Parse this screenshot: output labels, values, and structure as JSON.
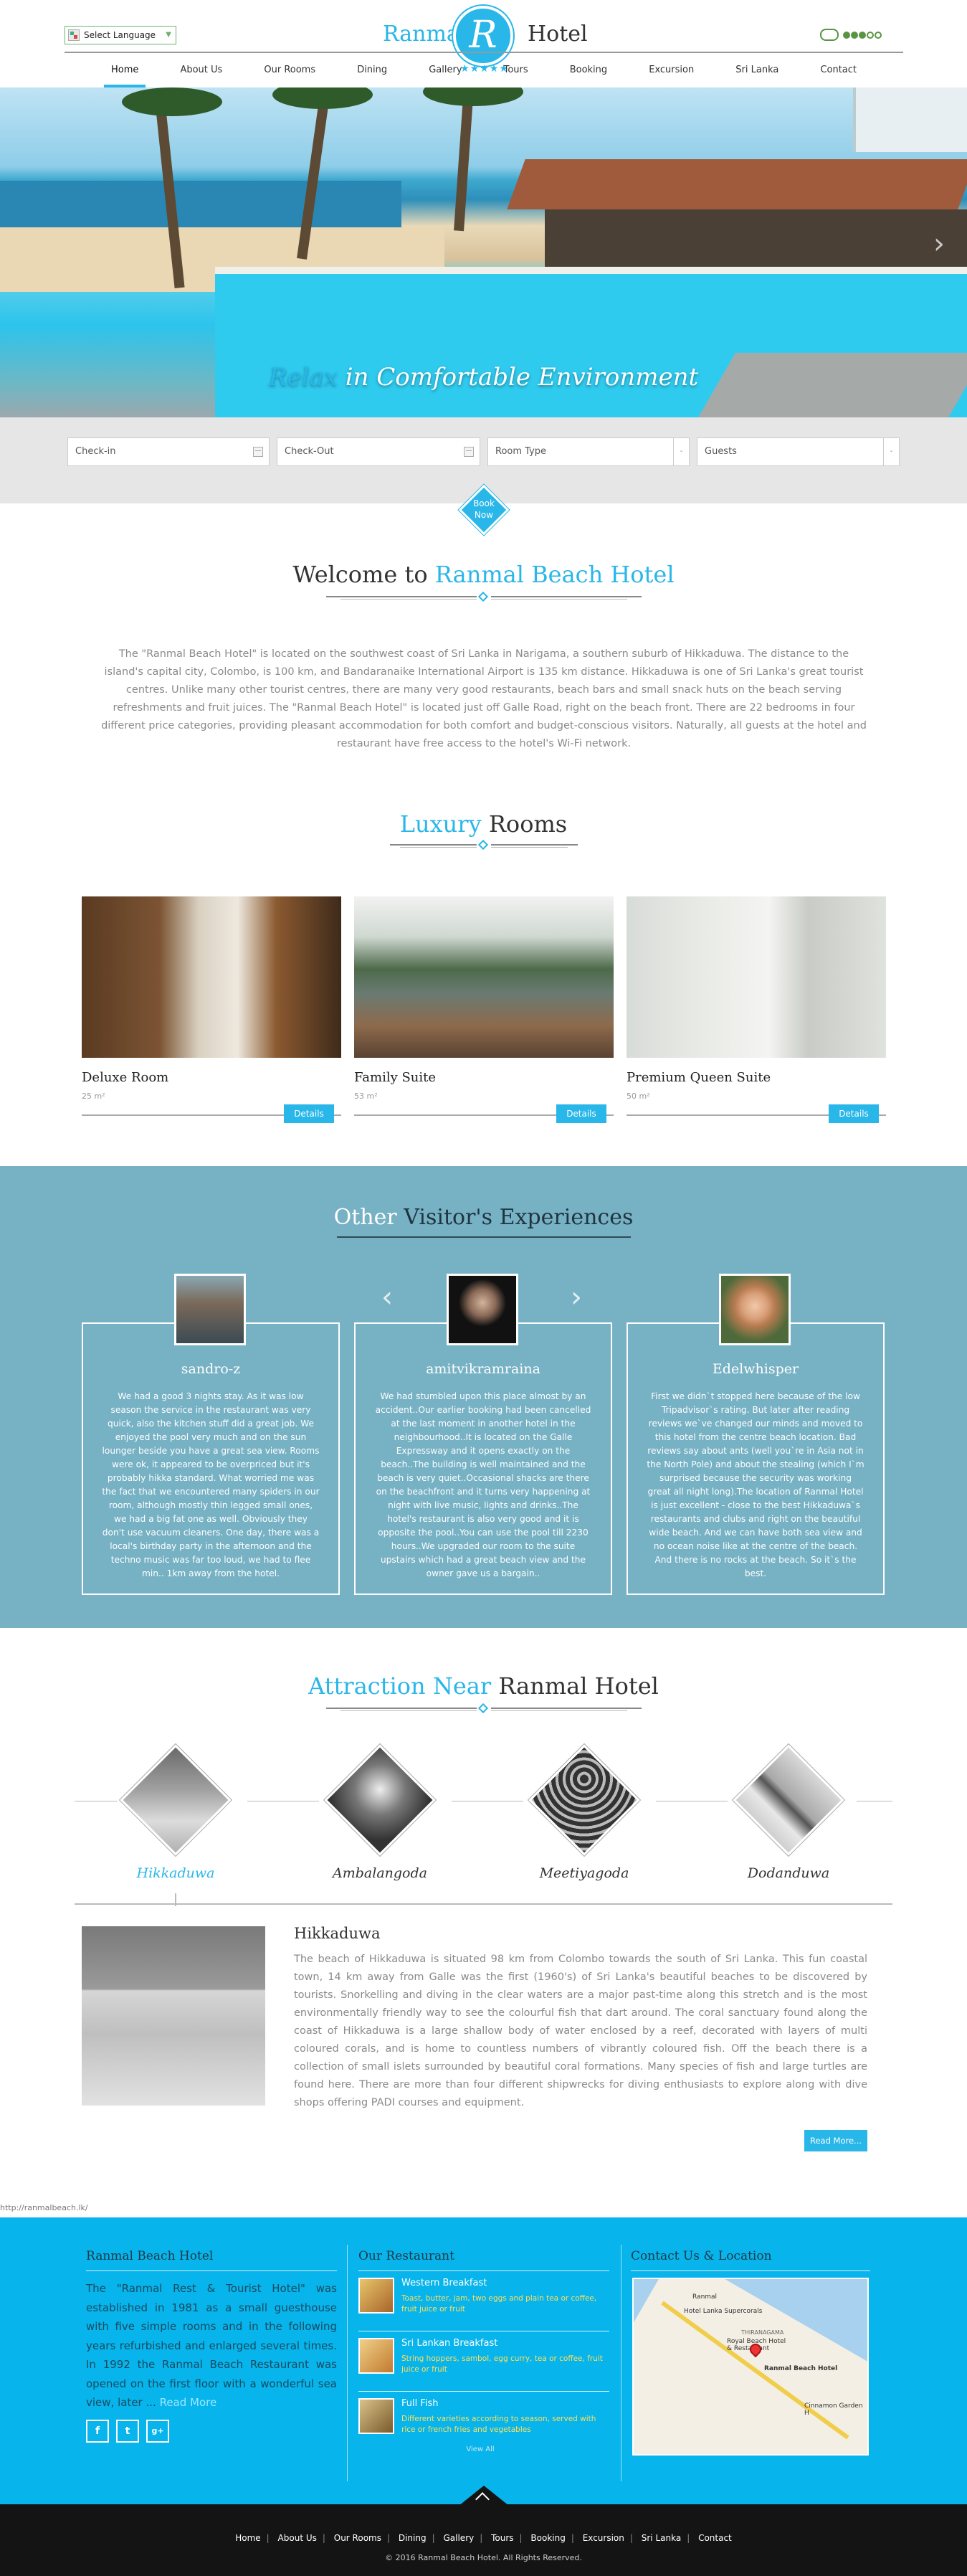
{
  "header": {
    "language_select": "Select Language",
    "logo_left": "Ranmal",
    "logo_letter": "R",
    "logo_right": "Hotel",
    "logo_stars": "★★★★★",
    "nav": [
      "Home",
      "About Us",
      "Our Rooms",
      "Dining",
      "Gallery",
      "Tours",
      "Booking",
      "Excursion",
      "Sri Lanka",
      "Contact"
    ],
    "active_nav": "Home"
  },
  "hero": {
    "caption_highlight": "Relax",
    "caption_rest": " in Comfortable Environment",
    "next_arrow": "›"
  },
  "booking": {
    "checkin_placeholder": "Check-in",
    "checkout_placeholder": "Check-Out",
    "room_type": "Room Type",
    "guests": "Guests",
    "book_now_line1": "Book",
    "book_now_line2": "Now"
  },
  "welcome": {
    "title_plain": "Welcome to ",
    "title_highlight": "Ranmal Beach Hotel",
    "text": "The \"Ranmal Beach Hotel\" is located on the southwest coast of Sri Lanka in Narigama, a southern suburb of Hikkaduwa. The distance to the island's capital city, Colombo, is 100 km, and Bandaranaike International Airport is 135 km distance. Hikkaduwa is one of Sri Lanka's great tourist centres. Unlike many other tourist centres, there are many very good restaurants, beach bars and small snack huts on the beach serving refreshments and fruit juices. The \"Ranmal Beach Hotel\" is located just off Galle Road, right on the beach front. There are 22 bedrooms in four different price categories, providing pleasant accommodation for both comfort and budget-conscious visitors. Naturally, all guests at the hotel and restaurant have free access to the hotel's Wi-Fi network."
  },
  "rooms": {
    "title_highlight": "Luxury",
    "title_plain": " Rooms",
    "items": [
      {
        "name": "Deluxe Room",
        "size": "25 m²",
        "button": "Details"
      },
      {
        "name": "Family Suite",
        "size": "53 m²",
        "button": "Details"
      },
      {
        "name": "Premium Queen Suite",
        "size": "50 m²",
        "button": "Details"
      }
    ]
  },
  "experiences": {
    "title_highlight": "Other",
    "title_plain": " Visitor's Experiences",
    "prev_arrow": "‹",
    "next_arrow": "›",
    "reviews": [
      {
        "name": "sandro-z",
        "text": "We had a good 3 nights stay. As it was low season the service in the restaurant was very quick, also the kitchen stuff did a great job. We enjoyed the pool very much and on the sun lounger beside you have a great sea view. Rooms were ok, it appeared to be overpriced but it's probably hikka standard. What worried me was the fact that we encountered many spiders in our room, although mostly thin legged small ones, we had a big fat one as well. Obviously they don't use vacuum cleaners. One day, there was a local's birthday party in the afternoon and the techno music was far too loud, we had to flee min.. 1km away from the hotel."
      },
      {
        "name": "amitvikramraina",
        "text": "We had stumbled upon this place almost by an accident..Our earlier booking had been cancelled at the last moment in another hotel in the neighbourhood..It is located on the Galle Expressway and it opens exactly on the beach..The building is well maintained and the beach is very quiet..Occasional shacks are there on the beachfront and it turns very happening at night with live music, lights and drinks..The hotel's restaurant is also very good and it is opposite the pool..You can use the pool till 2230 hours..We upgraded our room to the suite upstairs which had a great beach view and the owner gave us a bargain.."
      },
      {
        "name": "Edelwhisper",
        "text": "First we didn`t stopped here because of the low Tripadvisor`s rating. But later after reading reviews we`ve changed our minds and moved to this hotel from the centre beach location. Bad reviews say about ants (well you`re in Asia not in the North Pole) and about the stealing (which I`m surprised because the security was working great all night long).The location of Ranmal Hotel is just excellent - close to the best Hikkaduwa`s restaurants and clubs and right on the beautiful wide beach. And we can have both sea view and no ocean noise like at the centre of the beach. And there is no rocks at the beach. So it`s the best."
      }
    ]
  },
  "attractions": {
    "title_highlight": "Attraction Near",
    "title_plain": " Ranmal Hotel",
    "items": [
      "Hikkaduwa",
      "Ambalangoda",
      "Meetiyagoda",
      "Dodanduwa"
    ],
    "active": "Hikkaduwa",
    "detail_name": "Hikkaduwa",
    "detail_text": "The beach of Hikkaduwa is situated 98 km from Colombo towards the south of Sri Lanka. This fun coastal town, 14 km away from Galle was the first (1960's) of Sri Lanka's beautiful beaches to be discovered by tourists. Snorkelling and diving in the clear waters are a major past-time along this stretch and is the most environmentally friendly way to see the colourful fish that dart around. The coral sanctuary found along the coast of Hikkaduwa is a large shallow body of water enclosed by a reef, decorated with layers of multi coloured corals, and is home to countless numbers of vibrantly coloured fish. Off the beach there is a collection of small islets surrounded by beautiful coral formations. Many species of fish and large turtles are found here. There are more than four different shipwrecks for diving enthusiasts to explore along with dive shops offering PADI courses and equipment.",
    "read_more": "Read More..."
  },
  "status_url": "http://ranmalbeach.lk/",
  "footer": {
    "about_title": "Ranmal Beach Hotel",
    "about_text": "The \"Ranmal Rest & Tourist Hotel\" was established in 1981 as a small guesthouse with five simple rooms and in the following years refurbished and enlarged several times. In 1992 the Ranmal Beach Restaurant was opened on the first floor with a wonderful sea view, later ...",
    "about_read_more": "Read More",
    "social": [
      "f",
      "t",
      "g+"
    ],
    "restaurant_title": "Our Restaurant",
    "restaurant_items": [
      {
        "name": "Western Breakfast",
        "desc": "Toast, butter, jam, two eggs and plain tea or coffee, fruit juice or fruit"
      },
      {
        "name": "Sri Lankan Breakfast",
        "desc": "String hoppers, sambol, egg curry, tea or coffee, fruit juice or fruit"
      },
      {
        "name": "Full Fish",
        "desc": "Different varieties according to season, served with rice or french fries and vegetables"
      }
    ],
    "view_all": "View All",
    "contact_title": "Contact Us & Location",
    "map_labels": [
      "Ranmal",
      "Hotel Lanka Supercorals",
      "THIRANAGAMA",
      "Royal Beach Hotel & Restaurant",
      "Ranmal Beach Hotel",
      "Cinnamon Garden H"
    ]
  },
  "bottom": {
    "nav": [
      "Home",
      "About Us",
      "Our Rooms",
      "Dining",
      "Gallery",
      "Tours",
      "Booking",
      "Excursion",
      "Sri Lanka",
      "Contact"
    ],
    "copyright": "© 2016 Ranmal Beach Hotel. All Rights Reserved."
  },
  "colors": {
    "accent": "#29b6e8",
    "experiences_bg": "#77b1c4",
    "footer_bg": "#07b4ec",
    "bottom_bg": "#141414"
  }
}
